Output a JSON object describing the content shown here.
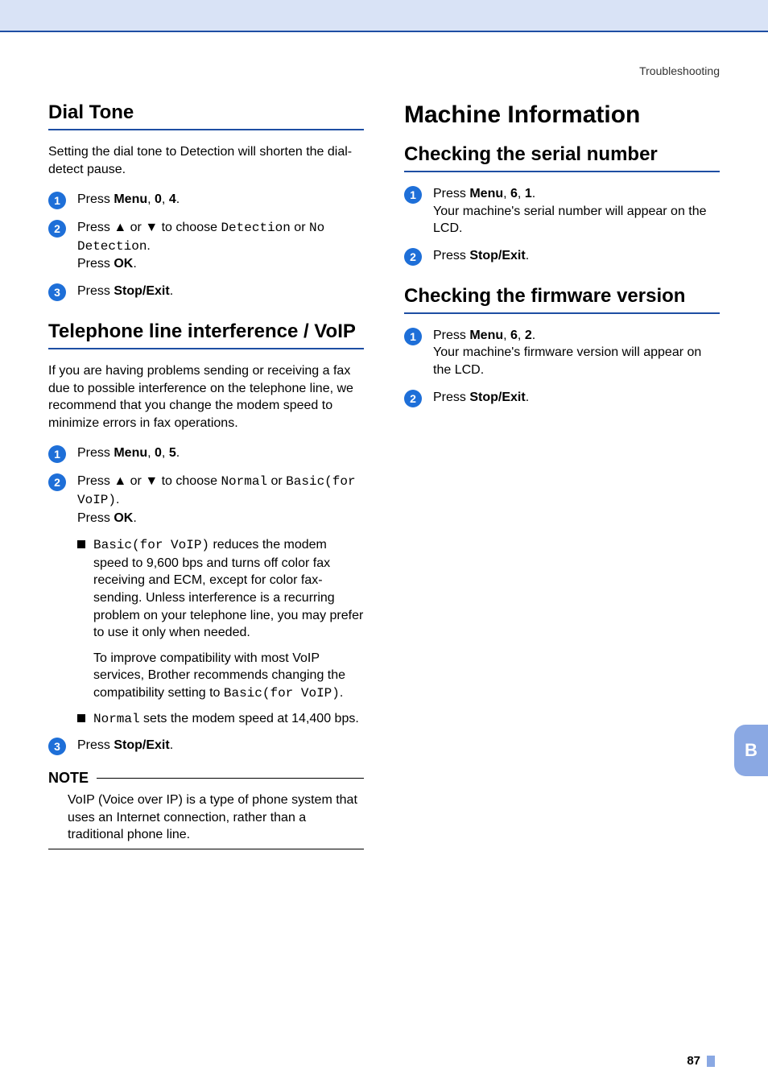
{
  "breadcrumb": "Troubleshooting",
  "sideTab": "B",
  "pageNumber": "87",
  "left": {
    "h2a": "Dial Tone",
    "paraA": "Setting the dial tone to Detection will shorten the dial-detect pause.",
    "s1_pre": "Press ",
    "s1_b1": "Menu",
    "s1_c1": ", ",
    "s1_b2": "0",
    "s1_c2": ", ",
    "s1_b3": "4",
    "s1_post": ".",
    "s2_pre": "Press ",
    "s2_up": "▲",
    "s2_or": " or ",
    "s2_dn": "▼",
    "s2_mid": " to choose ",
    "s2_m1": "Detection",
    "s2_or2": " or ",
    "s2_m2": "No Detection",
    "s2_dot": ".",
    "s2_l2a": "Press ",
    "s2_l2b": "OK",
    "s2_l2c": ".",
    "s3_pre": "Press ",
    "s3_b": "Stop/Exit",
    "s3_post": ".",
    "h2b": "Telephone line interference / VoIP",
    "paraB": "If you are having problems sending or receiving a fax due to possible interference on the telephone line, we recommend that you change the modem speed to minimize errors in fax operations.",
    "b1_pre": "Press ",
    "b1_b1": "Menu",
    "b1_c1": ", ",
    "b1_b2": "0",
    "b1_c2": ", ",
    "b1_b3": "5",
    "b1_post": ".",
    "b2_pre": "Press ",
    "b2_up": "▲",
    "b2_or": " or ",
    "b2_dn": "▼",
    "b2_mid": " to choose ",
    "b2_m1": "Normal",
    "b2_or2": " or ",
    "b2_m2": "Basic(for VoIP)",
    "b2_dot": ".",
    "b2_l2a": "Press ",
    "b2_l2b": "OK",
    "b2_l2c": ".",
    "sub1_m": "Basic(for VoIP)",
    "sub1_t": " reduces the modem speed to 9,600 bps and turns off color fax receiving and ECM, except for color fax-sending. Unless interference is a recurring problem on your telephone line, you may prefer to use it only when needed.",
    "sub1_p_a": "To improve compatibility with most VoIP services, Brother recommends changing the compatibility setting to ",
    "sub1_p_m": "Basic(for VoIP)",
    "sub1_p_dot": ".",
    "sub2_m": "Normal",
    "sub2_t": " sets the modem speed at 14,400 bps.",
    "b3_pre": "Press ",
    "b3_b": "Stop/Exit",
    "b3_post": ".",
    "noteLabel": "NOTE",
    "noteBody": "VoIP (Voice over IP) is a type of phone system that uses an Internet connection, rather than a traditional phone line."
  },
  "right": {
    "h1": "Machine Information",
    "h2a": "Checking the serial number",
    "a1_pre": "Press ",
    "a1_b1": "Menu",
    "a1_c1": ", ",
    "a1_b2": "6",
    "a1_c2": ", ",
    "a1_b3": "1",
    "a1_post": ".",
    "a1_l2": "Your machine's serial number will appear on the LCD.",
    "a2_pre": "Press ",
    "a2_b": "Stop/Exit",
    "a2_post": ".",
    "h2b": "Checking the firmware version",
    "c1_pre": "Press ",
    "c1_b1": "Menu",
    "c1_c1": ", ",
    "c1_b2": "6",
    "c1_c2": ", ",
    "c1_b3": "2",
    "c1_post": ".",
    "c1_l2": "Your machine's firmware version will appear on the LCD.",
    "c2_pre": "Press ",
    "c2_b": "Stop/Exit",
    "c2_post": "."
  }
}
